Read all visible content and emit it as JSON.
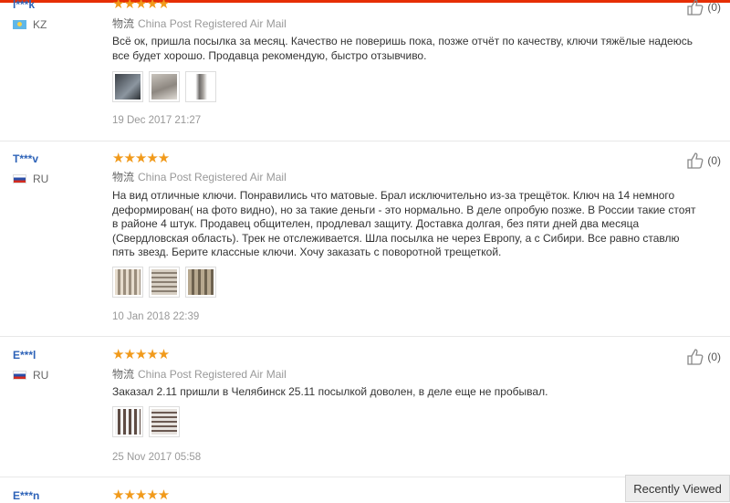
{
  "reviews": [
    {
      "user": "l***k",
      "country": "KZ",
      "stars": "★★★★★",
      "ship_label": "物流",
      "ship_method": "China Post Registered Air Mail",
      "text": "Всё ок, пришла посылка за месяц. Качество не поверишь пока, позже отчёт по качеству, ключи тяжёлые надеюсь все будет хорошо. Продавца рекомендую, быстро отзывчиво.",
      "date": "19 Dec 2017 21:27",
      "helpful_count": "(0)"
    },
    {
      "user": "T***v",
      "country": "RU",
      "stars": "★★★★★",
      "ship_label": "物流",
      "ship_method": "China Post Registered Air Mail",
      "text": "На вид отличные ключи. Понравились что матовые. Брал исключительно из-за трещёток. Ключ на 14 немного деформирован( на фото видно), но за такие деньги - это нормально. В деле опробую позже. В России такие стоят в районе 4 штук. Продавец общителен, продлевал защиту. Доставка долгая, без пяти дней два месяца (Свердловская область). Трек не отслеживается. Шла посылка не через Европу, а с Сибири. Все равно ставлю пять звезд. Берите классные ключи. Хочу заказать с поворотной трещеткой.",
      "date": "10 Jan 2018 22:39",
      "helpful_count": "(0)"
    },
    {
      "user": "E***l",
      "country": "RU",
      "stars": "★★★★★",
      "ship_label": "物流",
      "ship_method": "China Post Registered Air Mail",
      "text": "Заказал 2.11 пришли в Челябинск 25.11 посылкой доволен, в деле еще не пробывал.",
      "date": "25 Nov 2017 05:58",
      "helpful_count": "(0)"
    },
    {
      "user": "E***n",
      "stars": "★★★★★"
    }
  ],
  "recently_viewed": "Recently Viewed",
  "colors": {
    "accent": "#e62e04",
    "star": "#f19a1b",
    "link": "#2e63b8"
  }
}
